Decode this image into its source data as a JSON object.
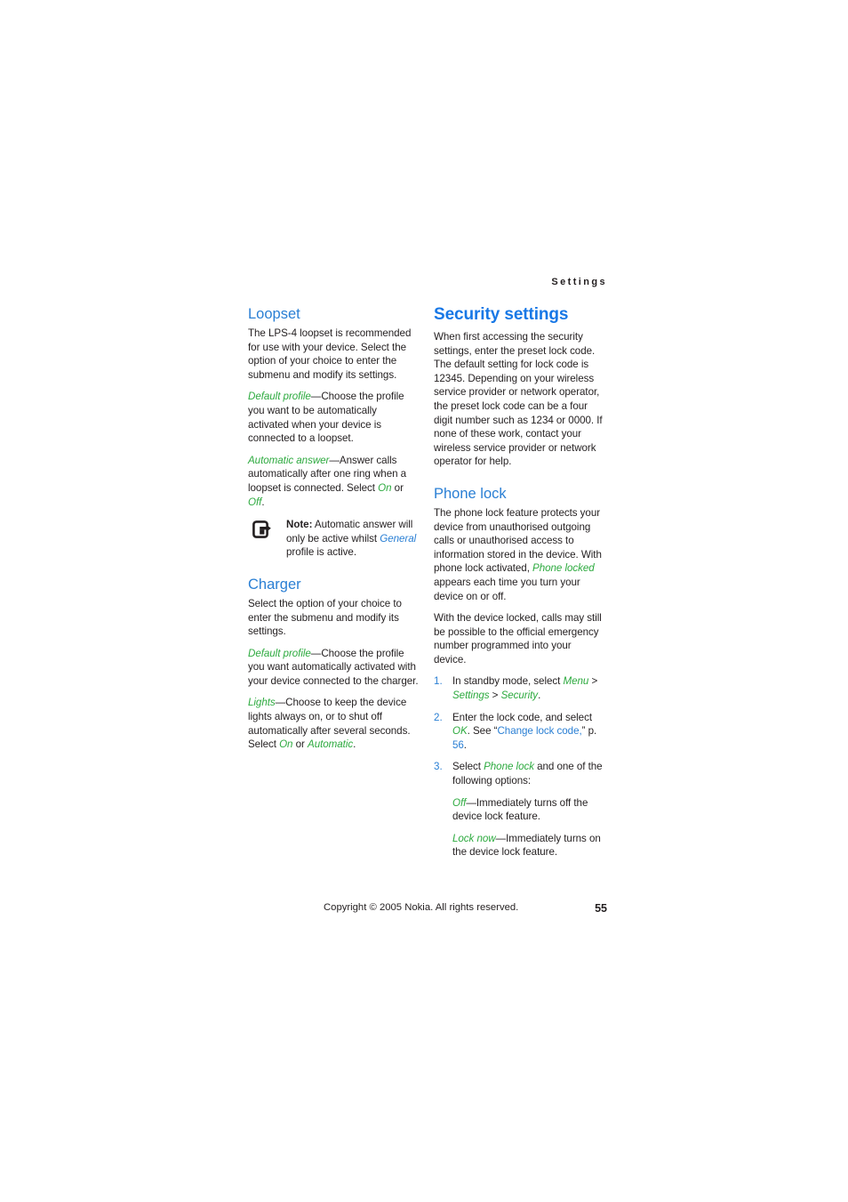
{
  "header": {
    "running_head": "Settings"
  },
  "left_column": {
    "loopset": {
      "heading": "Loopset",
      "intro": "The LPS-4 loopset is recommended for use with your device. Select the option of your choice to enter the submenu and modify its settings.",
      "default_profile_term": "Default profile",
      "default_profile_text": "—Choose the profile you want to be automatically activated when your device is connected to a loopset.",
      "automatic_answer_term": "Automatic answer",
      "automatic_answer_text_1": "—Answer calls automatically after one ring when a loopset is connected. Select ",
      "automatic_answer_on": "On",
      "automatic_answer_or": " or ",
      "automatic_answer_off": "Off",
      "automatic_answer_period": "."
    },
    "note": {
      "icon": "note-device-arrow-icon",
      "label": "Note:",
      "text_1": " Automatic answer will only be active whilst ",
      "term_general": "General",
      "text_2": " profile is active."
    },
    "charger": {
      "heading": "Charger",
      "intro": "Select the option of your choice to enter the submenu and modify its settings.",
      "default_profile_term": "Default profile",
      "default_profile_text": "—Choose the profile you want automatically activated with your device connected to the charger.",
      "lights_term": "Lights",
      "lights_text_1": "—Choose to keep the device lights always on, or to shut off automatically after several seconds. Select ",
      "lights_on": "On",
      "lights_or": " or ",
      "lights_automatic": "Automatic",
      "lights_period": "."
    }
  },
  "right_column": {
    "security_settings": {
      "heading": "Security settings",
      "intro": "When first accessing the security settings, enter the preset lock code. The default setting for lock code is 12345. Depending on your wireless service provider or network operator, the preset lock code can be a four digit number such as 1234 or 0000. If none of these work, contact your wireless service provider or network operator for help."
    },
    "phone_lock": {
      "heading": "Phone lock",
      "para_1_text_1": "The phone lock feature protects your device from unauthorised outgoing calls or unauthorised access to information stored in the device. With phone lock activated, ",
      "para_1_term": "Phone locked",
      "para_1_text_2": " appears each time you turn your device on or off.",
      "para_2": "With the device locked, calls may still be possible to the official emergency number programmed into your device.",
      "steps": [
        {
          "num": "1.",
          "text_1": "In standby mode, select ",
          "term_1": "Menu",
          "text_2": " > ",
          "term_2": "Settings",
          "text_3": " > ",
          "term_3": "Security",
          "text_4": "."
        },
        {
          "num": "2.",
          "text_1": "Enter the lock code, and select ",
          "term_1": "OK",
          "text_2": ". See “",
          "link_1": "Change lock code,",
          "text_3": "” p. ",
          "link_2": "56",
          "text_4": "."
        },
        {
          "num": "3.",
          "text_1": "Select ",
          "term_1": "Phone lock",
          "text_2": " and one of the following options:",
          "option_1_term": "Off",
          "option_1_text": "—Immediately turns off the device lock feature.",
          "option_2_term": "Lock now",
          "option_2_text": "—Immediately turns on the device lock feature."
        }
      ]
    }
  },
  "footer": {
    "copyright": "Copyright © 2005 Nokia. All rights reserved.",
    "page_number": "55"
  },
  "colors": {
    "heading_blue": "#1878e6",
    "subheading_blue": "#2a7fd4",
    "ui_term_green": "#2daa3f",
    "body_text": "#231f20"
  }
}
